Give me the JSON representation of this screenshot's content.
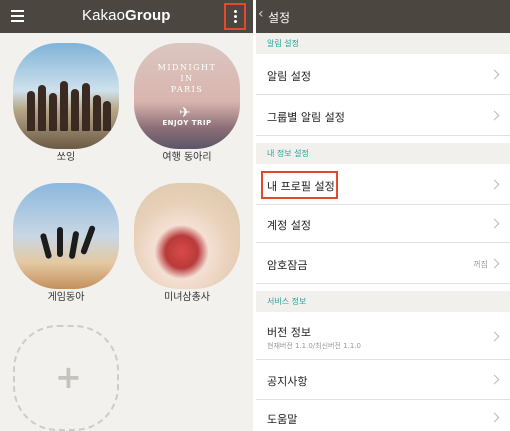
{
  "left": {
    "brand_prefix": "Kakao",
    "brand_suffix": "Group",
    "groups": [
      {
        "label": "쏘잉"
      },
      {
        "label": "여행 동아리"
      },
      {
        "label": "게임동아"
      },
      {
        "label": "미녀삼총사"
      }
    ],
    "travel_image": {
      "line1": "MIDNIGHT",
      "line2": "IN",
      "line3": "PARIS",
      "enjoy": "ENJOY TRIP"
    },
    "add_symbol": "+"
  },
  "right": {
    "back_symbol": "‹",
    "title": "설정",
    "sections": [
      {
        "header": "알림 설정",
        "rows": [
          {
            "label": "알림 설정"
          },
          {
            "label": "그룹별 알림 설정"
          }
        ]
      },
      {
        "header": "내 정보 설정",
        "rows": [
          {
            "label": "내 프로필 설정"
          },
          {
            "label": "계정 설정"
          },
          {
            "label": "암호잠금",
            "value": "꺼짐"
          }
        ]
      },
      {
        "header": "서비스 정보",
        "rows": [
          {
            "label": "버전 정보",
            "sub": "현재버전 1.1.0/최신버전 1.1.0"
          },
          {
            "label": "공지사항"
          },
          {
            "label": "도움말"
          }
        ]
      }
    ]
  },
  "colors": {
    "header_bg": "#4b4640",
    "section_accent": "#26a39a",
    "highlight_border": "#e34a2c"
  },
  "icons": [
    "hamburger-icon",
    "more-vertical-icon",
    "back-chevron-icon",
    "chevron-right-icon",
    "plus-icon",
    "airplane-icon"
  ]
}
